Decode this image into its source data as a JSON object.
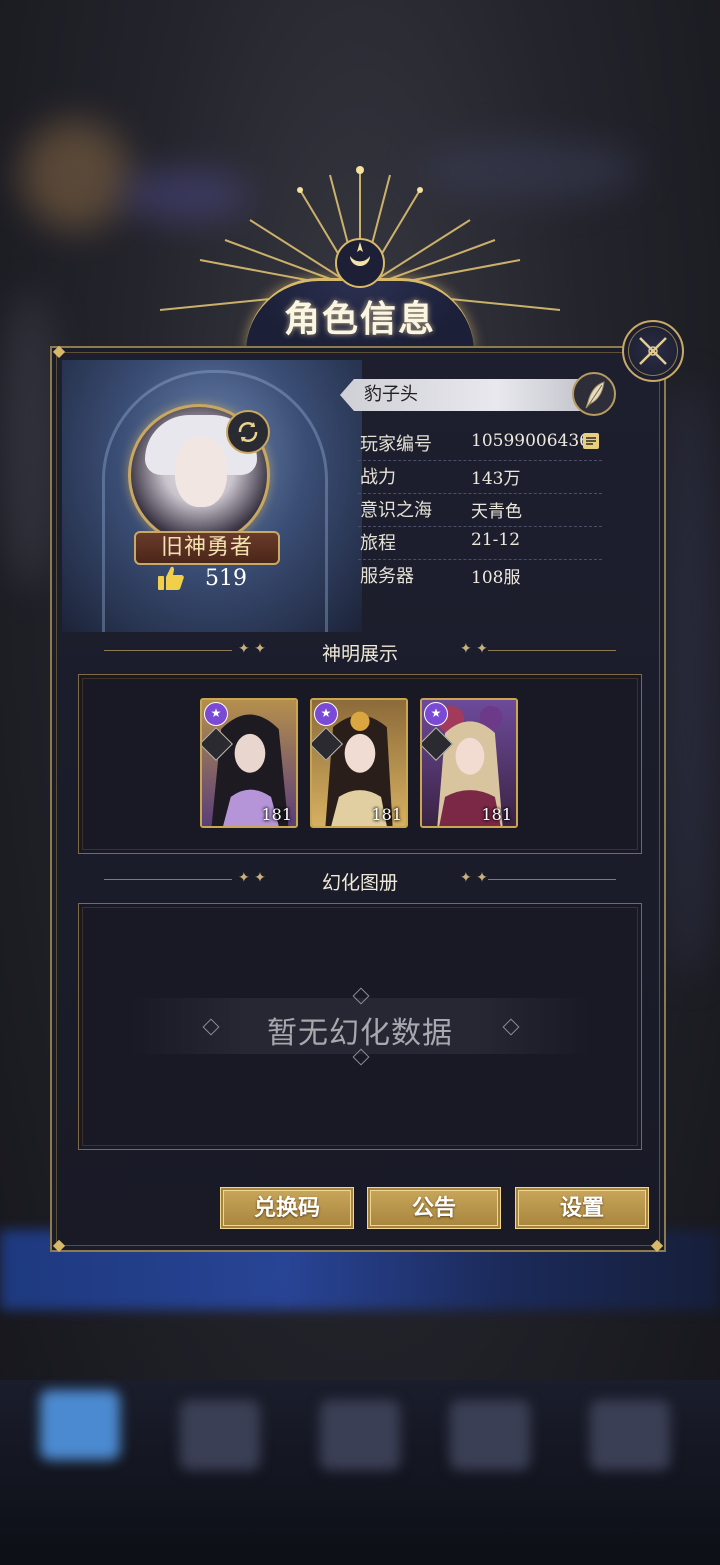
{
  "header": {
    "title": "角色信息"
  },
  "profile": {
    "name": "豹子头",
    "title_badge": "旧神勇者",
    "likes": "519"
  },
  "info_rows": [
    {
      "label": "玩家编号",
      "value": "10599006436"
    },
    {
      "label": "战力",
      "value": "143万"
    },
    {
      "label": "意识之海",
      "value": "天青色"
    },
    {
      "label": "旅程",
      "value": "21-12"
    },
    {
      "label": "服务器",
      "value": "108服"
    }
  ],
  "sections": {
    "gods_title": "神明展示",
    "transform_title": "幻化图册",
    "empty_text": "暂无幻化数据"
  },
  "cards": [
    {
      "level": "181",
      "star": "★",
      "accent": "#6a3e8f"
    },
    {
      "level": "181",
      "star": "★",
      "accent": "#a57a2c"
    },
    {
      "level": "181",
      "star": "★",
      "accent": "#5b2f6f"
    }
  ],
  "buttons": {
    "redeem": "兑换码",
    "notice": "公告",
    "settings": "设置"
  },
  "colors": {
    "gold": "#d8b96a",
    "panel": "#1d1f2f",
    "button": "#b8944a"
  }
}
